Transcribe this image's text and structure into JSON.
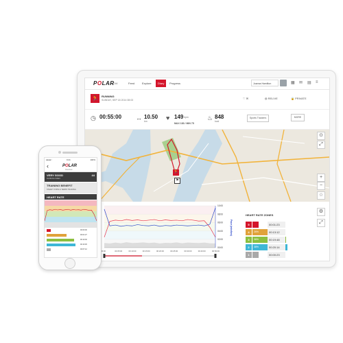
{
  "colors": {
    "brand_red": "#d4152b",
    "line_red": "#e8334a",
    "line_blue": "#2946c9",
    "dark_panel": "#3d3d3d"
  },
  "desktop": {
    "topbar": {
      "logo_pre": "P",
      "logo_o": "O",
      "logo_post": "LAR",
      "brand_sub": "FLOW",
      "nav": [
        "Feed",
        "Explore",
        "Diary",
        "Progress"
      ],
      "active_nav": "Diary",
      "user": "Joanna Hamilton",
      "icons": [
        "grid-icon",
        "bell-icon",
        "cart-icon",
        "menu-icon"
      ]
    },
    "session": {
      "sport": "RUNNING",
      "date": "SUNDAY, SEP 18 2014 08:03",
      "actions": [
        "♡ ✉",
        "◍ RELIVE",
        "🔒 PRIVATE"
      ]
    },
    "stats": {
      "duration": "00:55:00",
      "distance": "10.50",
      "distance_unit": "km",
      "heart_rate": "149",
      "heart_rate_unit": "bpm",
      "heart_rate_sub": "MAX 183 / MIN 75",
      "calories": "848",
      "calories_unit": "kcal",
      "sport_btn": "Sports Trackers",
      "more_btn": "MORE"
    },
    "map": {
      "buttons": [
        "⊙",
        "⤢",
        "+",
        "−",
        "☆"
      ]
    },
    "chart_data": {
      "type": "line",
      "title": "",
      "y_right_label": "Pace (min/km)",
      "y_right_ticks": [
        "00:00",
        "02:00",
        "04:00",
        "06:00",
        "08:00",
        "10:00"
      ],
      "x_ticks": [
        "00:00",
        "00:05:00",
        "00:10:00",
        "00:15:00",
        "00:20:00",
        "00:25:00",
        "00:30:00",
        "00:40:00",
        "00:50:00"
      ],
      "series": [
        {
          "name": "",
          "color": "#e8334a",
          "values": [
            95,
            148,
            152,
            150,
            154,
            151,
            153,
            150,
            152,
            154,
            150,
            153,
            151,
            152,
            150,
            154,
            152,
            149,
            150,
            128,
            95
          ]
        },
        {
          "name": "",
          "color": "#2946c9",
          "values": [
            9.2,
            5.2,
            5.4,
            5.1,
            5.3,
            5.2,
            5.5,
            5.3,
            5.2,
            5.4,
            5.1,
            5.3,
            5.2,
            5.4,
            5.3,
            5.2,
            5.3,
            5.4,
            5.2,
            5.6,
            9.5
          ]
        },
        {
          "name": "",
          "color": "#9a9a9a",
          "values": [
            2.2,
            2.0,
            2.4,
            2.1,
            2.6,
            2.2,
            2.3,
            2.5,
            2.2,
            2.4,
            2.0,
            2.3,
            2.2,
            2.5,
            2.1,
            2.4,
            2.3,
            2.2,
            2.4,
            2.1,
            2.0
          ]
        }
      ]
    },
    "zones": {
      "title": "HEART RATE ZONES",
      "rows": [
        {
          "zone": "5",
          "pct": "",
          "fill": 0.05,
          "time": "00:01:23",
          "color": "#d4152b"
        },
        {
          "zone": "4",
          "pct": "26%",
          "fill": 0.26,
          "time": "00:13:12",
          "color": "#e0a23a"
        },
        {
          "zone": "3",
          "pct": "36%",
          "fill": 0.36,
          "time": "00:19:48",
          "color": "#8cbf3f"
        },
        {
          "zone": "2",
          "pct": "38%",
          "fill": 0.38,
          "time": "00:20:14",
          "color": "#3eb7d6"
        },
        {
          "zone": "1",
          "pct": "",
          "fill": 0.02,
          "time": "00:00:23",
          "color": "#a9a9a9"
        }
      ]
    }
  },
  "phone": {
    "status_left": "●●●●○",
    "status_time": "9:41",
    "status_right": "100%",
    "logo_pre": "P",
    "logo_o": "O",
    "logo_post": "LAR",
    "sub": "Overview",
    "summary_title": "VERY GOOD",
    "summary_num": "44",
    "summary_sub": "RUNNING INDEX",
    "benefit_title": "TRAINING BENEFIT",
    "benefit_text": "STEADY STATE & TEMPO TRAINING",
    "hr_title": "HEART RATE",
    "zone_times": [
      "00:00:00",
      "00:01:27",
      "00:10:30",
      "00:13:45",
      "00:07:12"
    ]
  }
}
